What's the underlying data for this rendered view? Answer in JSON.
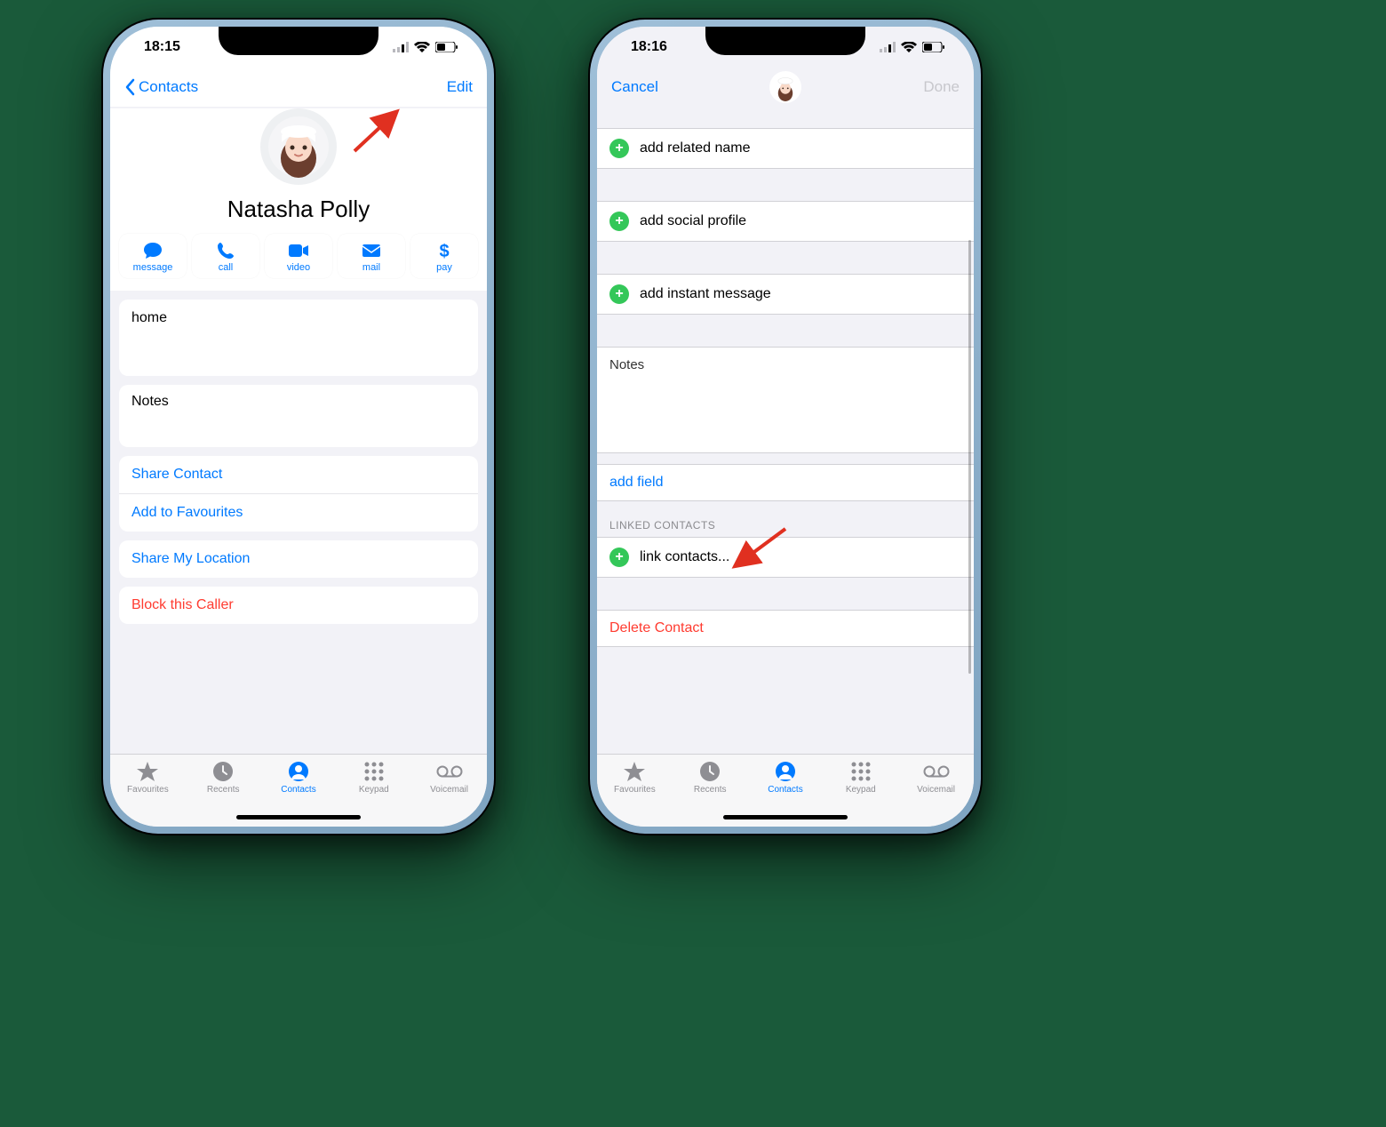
{
  "left": {
    "status": {
      "time": "18:15"
    },
    "nav": {
      "back": "Contacts",
      "edit": "Edit"
    },
    "contact": {
      "name": "Natasha Polly"
    },
    "actions": {
      "message": "message",
      "call": "call",
      "video": "video",
      "mail": "mail",
      "pay": "pay"
    },
    "fields": {
      "home": "home",
      "notes": "Notes"
    },
    "links": {
      "share_contact": "Share Contact",
      "add_favourites": "Add to Favourites",
      "share_location": "Share My Location",
      "block": "Block this Caller"
    }
  },
  "right": {
    "status": {
      "time": "18:16"
    },
    "nav": {
      "cancel": "Cancel",
      "done": "Done"
    },
    "rows": {
      "add_related": "add related name",
      "add_social": "add social profile",
      "add_im": "add instant message",
      "notes": "Notes",
      "add_field": "add field",
      "linked_header": "LINKED CONTACTS",
      "link_contacts": "link contacts...",
      "delete": "Delete Contact"
    }
  },
  "tabs": {
    "favourites": "Favourites",
    "recents": "Recents",
    "contacts": "Contacts",
    "keypad": "Keypad",
    "voicemail": "Voicemail"
  }
}
